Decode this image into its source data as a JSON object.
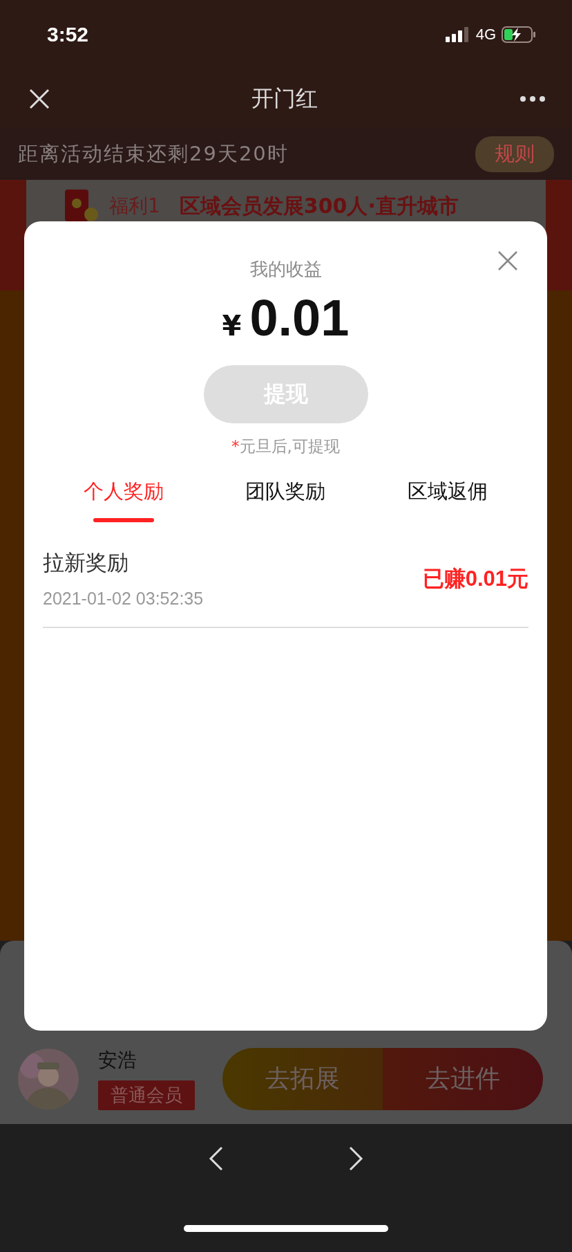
{
  "status_bar": {
    "time": "3:52",
    "network": "4G",
    "charging": true
  },
  "nav": {
    "title": "开门红"
  },
  "background": {
    "countdown": "距离活动结束还剩29天20时",
    "rules_button": "规则",
    "benefit": {
      "tag": "福利1",
      "title": "区域会员发展300人·直升城市"
    }
  },
  "modal": {
    "title": "我的收益",
    "currency": "¥",
    "amount": "0.01",
    "withdraw_button": {
      "label": "提现",
      "disabled": true
    },
    "note_mark": "*",
    "note": "元旦后,可提现",
    "tabs": [
      {
        "label": "个人奖励",
        "selected": true
      },
      {
        "label": "团队奖励",
        "selected": false
      },
      {
        "label": "区域返佣",
        "selected": false
      }
    ],
    "records": [
      {
        "title": "拉新奖励",
        "time": "2021-01-02 03:52:35",
        "amount": "已赚0.01元"
      }
    ]
  },
  "member": {
    "name": "安浩",
    "level": "普通会员"
  },
  "actions": [
    {
      "label": "去拓展",
      "kind": "expand"
    },
    {
      "label": "去进件",
      "kind": "submit"
    }
  ]
}
